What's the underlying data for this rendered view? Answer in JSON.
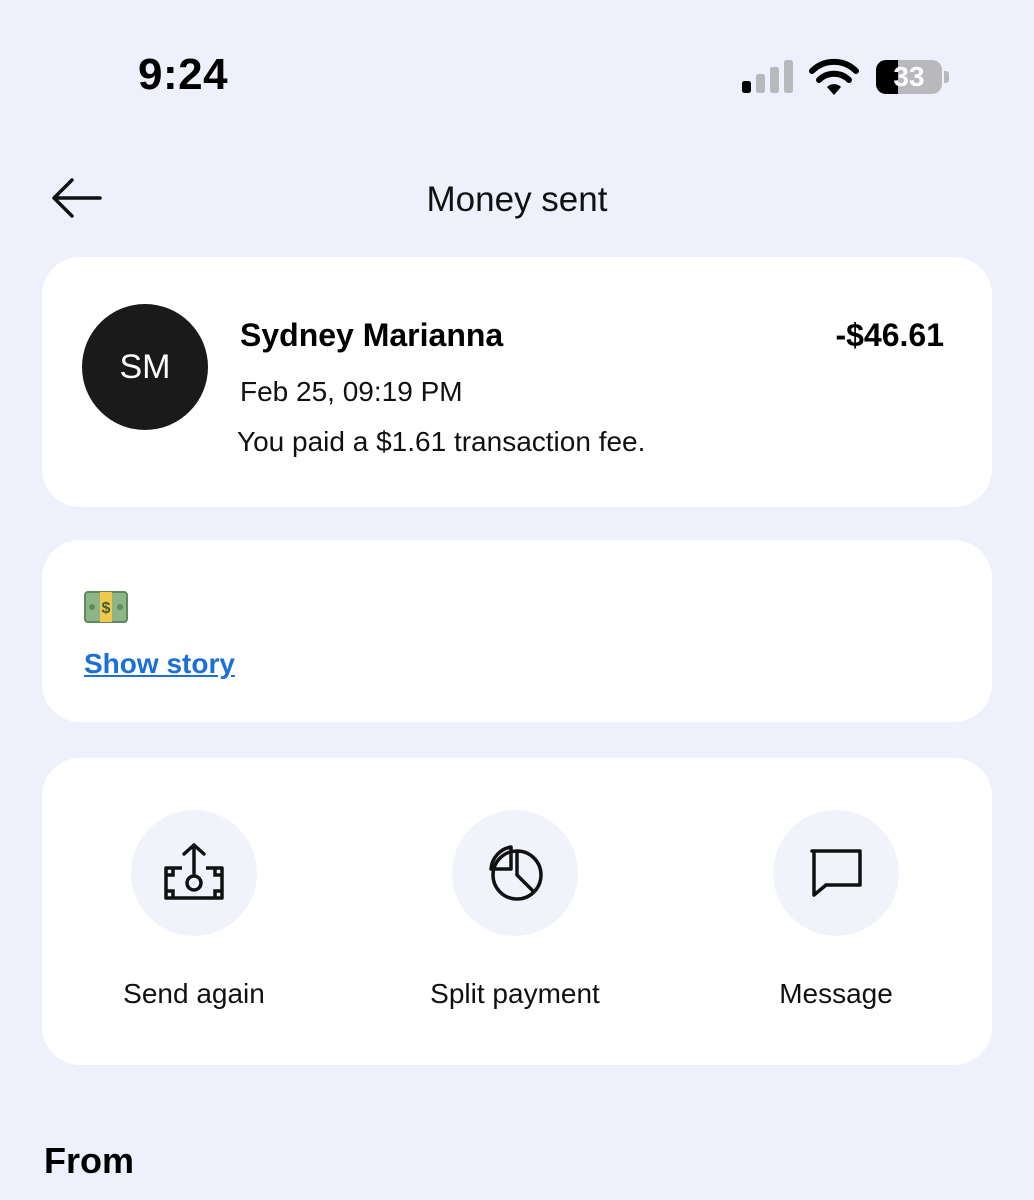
{
  "status_bar": {
    "time": "9:24",
    "battery_level": "33",
    "battery_percent": 33,
    "icons": [
      "cellular-signal-icon",
      "wifi-icon",
      "battery-icon"
    ]
  },
  "header": {
    "title": "Money sent",
    "back_icon": "arrow-left-icon"
  },
  "transaction": {
    "avatar_initials": "SM",
    "recipient": "Sydney Marianna",
    "amount": "-$46.61",
    "date": "Feb 25, 09:19 PM",
    "fee_note": "You paid a $1.61 transaction fee."
  },
  "story": {
    "emoji_icon": "money-banknote-icon",
    "link_label": "Show story"
  },
  "actions": [
    {
      "label": "Send again",
      "icon": "send-money-icon"
    },
    {
      "label": "Split payment",
      "icon": "pie-chart-icon"
    },
    {
      "label": "Message",
      "icon": "chat-bubble-icon"
    }
  ],
  "sections": {
    "from_heading": "From"
  },
  "colors": {
    "background": "#eef1fb",
    "card": "#ffffff",
    "link": "#1a6fd8",
    "avatar": "#1a1a1a",
    "action_circle": "#f1f3fa"
  }
}
